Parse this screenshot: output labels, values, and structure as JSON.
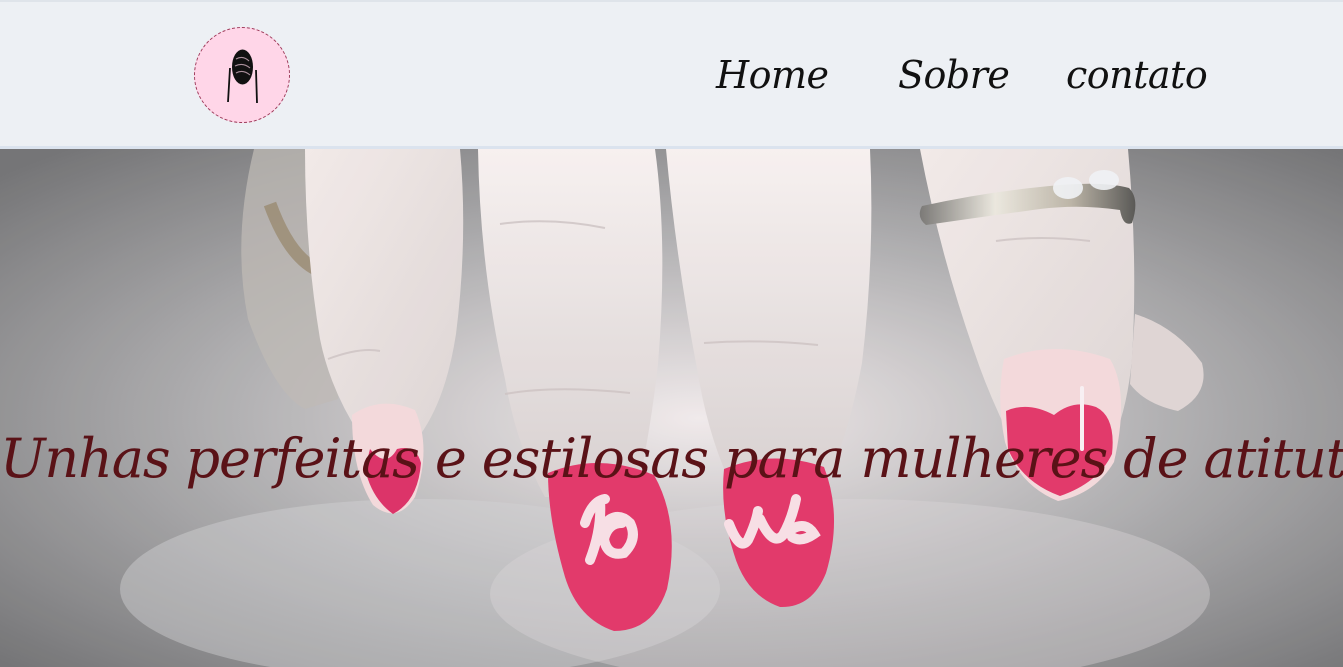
{
  "header": {
    "logo_icon": "nail-icon",
    "nav": [
      {
        "label": "Home"
      },
      {
        "label": "Sobre"
      },
      {
        "label": "contato"
      }
    ]
  },
  "hero": {
    "title": "Unhas perfeitas e estilosas para mulheres de atitute",
    "image_icon": "hand-with-love-nails-photo",
    "nail_text": "love"
  },
  "colors": {
    "header_bg": "#edf0f4",
    "logo_bg": "#ffd6e8",
    "nav_text": "#111111",
    "hero_title": "#5a1217",
    "nail_color": "#d81e58"
  }
}
